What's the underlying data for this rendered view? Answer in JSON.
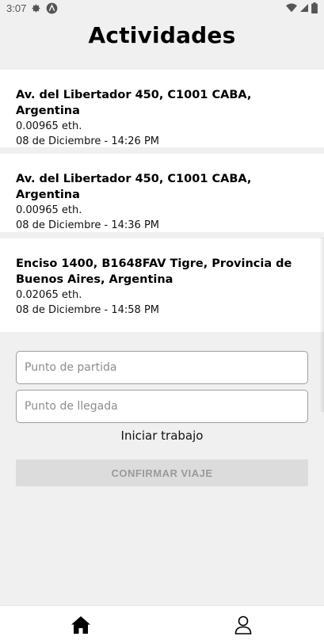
{
  "status_bar": {
    "time": "3:07"
  },
  "header": {
    "title": "Actividades"
  },
  "activities": [
    {
      "address": "Av. del Libertador 450, C1001 CABA, Argentina",
      "amount": "0.00965 eth.",
      "date": "08 de Diciembre - 14:26 PM"
    },
    {
      "address": "Av. del Libertador 450, C1001 CABA, Argentina",
      "amount": "0.00965 eth.",
      "date": "08 de Diciembre - 14:36 PM"
    },
    {
      "address": "Enciso 1400, B1648FAV Tigre, Provincia de Buenos Aires, Argentina",
      "amount": "0.02065 eth.",
      "date": "08 de Diciembre - 14:58 PM"
    }
  ],
  "form": {
    "start_placeholder": "Punto de partida",
    "end_placeholder": "Punto de llegada",
    "start_work_label": "Iniciar trabajo",
    "confirm_label": "CONFIRMAR VIAJE"
  },
  "bottom_nav": {
    "items": [
      {
        "icon": "home-icon"
      },
      {
        "icon": "user-icon"
      }
    ]
  },
  "colors": {
    "background": "#f0f0f0",
    "card": "#ffffff",
    "button_disabled": "#dcdcdc"
  }
}
